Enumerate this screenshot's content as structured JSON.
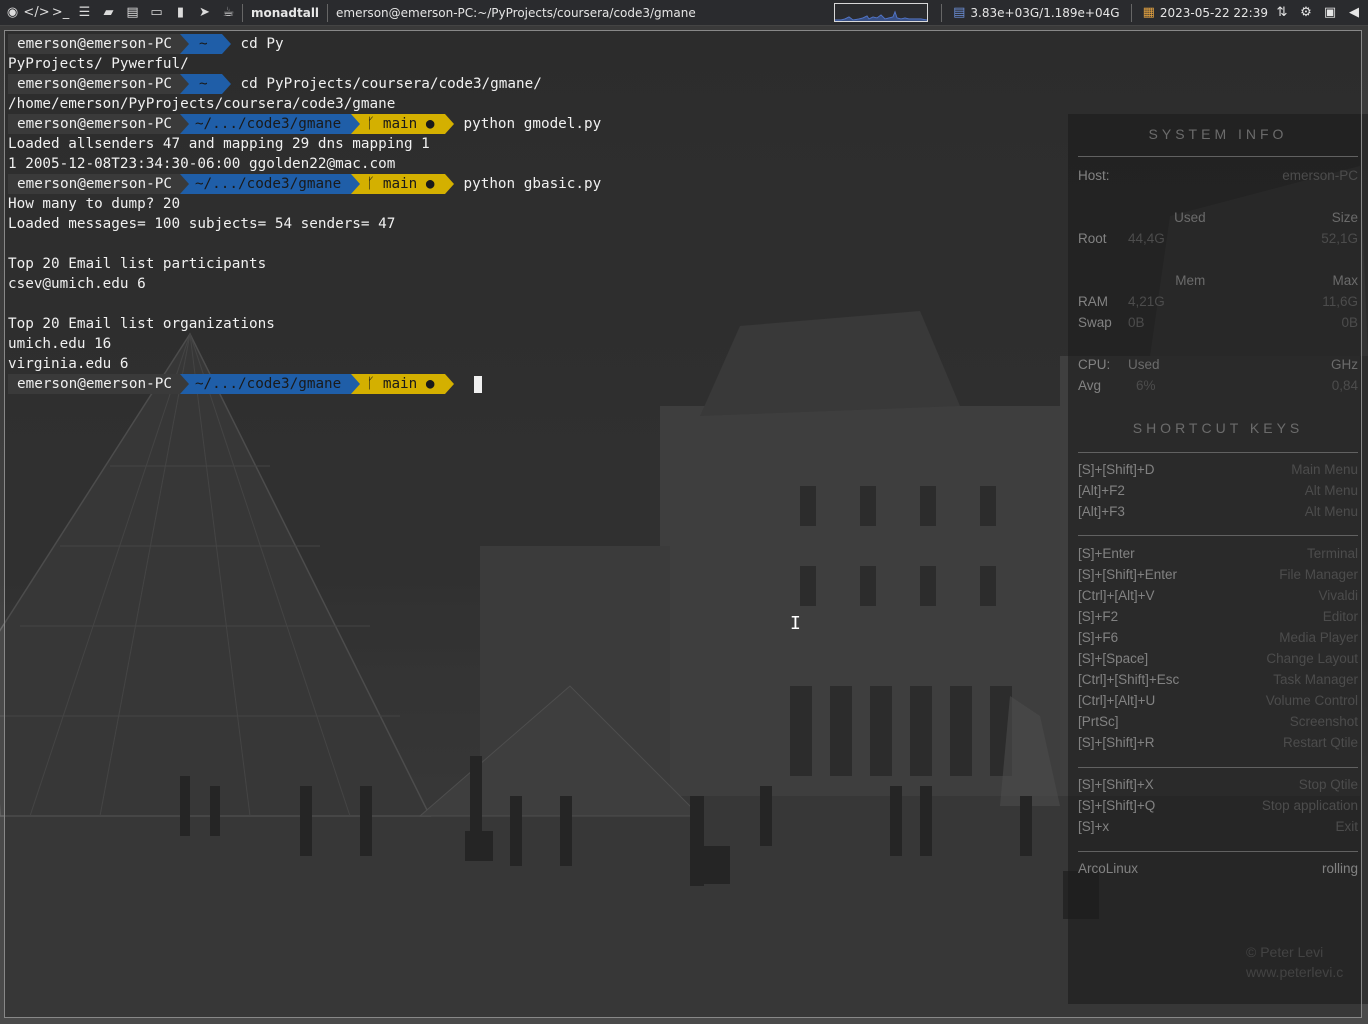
{
  "topbar": {
    "launchers": [
      {
        "name": "browser-icon",
        "glyph": "◉"
      },
      {
        "name": "code-icon",
        "glyph": "</>"
      },
      {
        "name": "terminal-icon",
        "glyph": ">_"
      },
      {
        "name": "files-list-icon",
        "glyph": "☰"
      },
      {
        "name": "folder-icon",
        "glyph": "▰"
      },
      {
        "name": "document-icon",
        "glyph": "▤"
      },
      {
        "name": "monitor-icon",
        "glyph": "▭"
      },
      {
        "name": "bookmark-icon",
        "glyph": "▮"
      },
      {
        "name": "telegram-icon",
        "glyph": "➤"
      },
      {
        "name": "coffee-icon",
        "glyph": "☕"
      }
    ],
    "workspace": "monadtall",
    "window_title": "emerson@emerson-PC:~/PyProjects/coursera/code3/gmane",
    "storage": "3.83e+03G/1.189e+04G",
    "datetime": "2023-05-22 22:39",
    "tray": [
      {
        "name": "network-updown-icon",
        "glyph": "⇅"
      },
      {
        "name": "settings-gear-icon",
        "glyph": "⚙"
      },
      {
        "name": "screenshot-icon",
        "glyph": "▣"
      },
      {
        "name": "volume-icon",
        "glyph": "◀"
      }
    ]
  },
  "terminal": {
    "user": "emerson@emerson-PC",
    "home_dir": "~",
    "project_dir": "~/.../code3/gmane",
    "git_branch": "main ●",
    "git_icon": "ᚴ",
    "lines": [
      {
        "type": "prompt",
        "dir": "home",
        "cmd": "cd Py"
      },
      {
        "type": "out",
        "text": "PyProjects/ Pywerful/"
      },
      {
        "type": "prompt",
        "dir": "home",
        "cmd": "cd PyProjects/coursera/code3/gmane/"
      },
      {
        "type": "out",
        "text": "/home/emerson/PyProjects/coursera/code3/gmane"
      },
      {
        "type": "prompt",
        "dir": "project",
        "cmd": "python gmodel.py"
      },
      {
        "type": "out",
        "text": "Loaded allsenders 47 and mapping 29 dns mapping 1"
      },
      {
        "type": "out",
        "text": "1 2005-12-08T23:34:30-06:00 ggolden22@mac.com"
      },
      {
        "type": "prompt",
        "dir": "project",
        "cmd": "python gbasic.py"
      },
      {
        "type": "out",
        "text": "How many to dump? 20"
      },
      {
        "type": "out",
        "text": "Loaded messages= 100 subjects= 54 senders= 47"
      },
      {
        "type": "out",
        "text": ""
      },
      {
        "type": "out",
        "text": "Top 20 Email list participants"
      },
      {
        "type": "out",
        "text": "csev@umich.edu 6"
      },
      {
        "type": "out",
        "text": ""
      },
      {
        "type": "out",
        "text": "Top 20 Email list organizations"
      },
      {
        "type": "out",
        "text": "umich.edu 16"
      },
      {
        "type": "out",
        "text": "virginia.edu 6"
      },
      {
        "type": "prompt",
        "dir": "project",
        "cmd": "",
        "cursor": true
      }
    ]
  },
  "conky": {
    "system_info_title": "SYSTEM INFO",
    "host_label": "Host:",
    "host_value": "emerson-PC",
    "used_label": "Used",
    "size_label": "Size",
    "root_label": "Root",
    "root_used": "44,4G",
    "root_size": "52,1G",
    "mem_label": "Mem",
    "max_label": "Max",
    "ram_label": "RAM",
    "ram_used": "4,21G",
    "ram_max": "11,6G",
    "swap_label": "Swap",
    "swap_used": "0B",
    "swap_max": "0B",
    "cpu_label": "CPU:",
    "cpu_used_label": "Used",
    "ghz_label": "GHz",
    "avg_label": "Avg",
    "cpu_used": "6%",
    "cpu_ghz": "0,84",
    "shortcut_title": "SHORTCUT KEYS",
    "shortcuts_1": [
      {
        "key": "[S]+[Shift]+D",
        "action": "Main Menu"
      },
      {
        "key": "[Alt]+F2",
        "action": "Alt Menu"
      },
      {
        "key": "[Alt]+F3",
        "action": "Alt Menu"
      }
    ],
    "shortcuts_2": [
      {
        "key": "[S]+Enter",
        "action": "Terminal"
      },
      {
        "key": "[S]+[Shift]+Enter",
        "action": "File Manager"
      },
      {
        "key": "[Ctrl]+[Alt]+V",
        "action": "Vivaldi"
      },
      {
        "key": "[S]+F2",
        "action": "Editor"
      },
      {
        "key": "[S]+F6",
        "action": "Media Player"
      },
      {
        "key": "[S]+[Space]",
        "action": "Change Layout"
      },
      {
        "key": "[Ctrl]+[Shift]+Esc",
        "action": "Task Manager"
      },
      {
        "key": "[Ctrl]+[Alt]+U",
        "action": "Volume Control"
      },
      {
        "key": "[PrtSc]",
        "action": "Screenshot"
      },
      {
        "key": "[S]+[Shift]+R",
        "action": "Restart Qtile"
      }
    ],
    "shortcuts_3": [
      {
        "key": "[S]+[Shift]+X",
        "action": "Stop Qtile"
      },
      {
        "key": "[S]+[Shift]+Q",
        "action": "Stop application"
      },
      {
        "key": "[S]+x",
        "action": "Exit"
      }
    ],
    "distro": "ArcoLinux",
    "release": "rolling"
  },
  "wallpaper": {
    "credit_line1": "© Peter Levi",
    "credit_line2": "www.peterlevi.c"
  },
  "colors": {
    "dir_segment": "#1f5ea8",
    "git_segment": "#d4b000",
    "user_segment": "#3a3a3a"
  }
}
